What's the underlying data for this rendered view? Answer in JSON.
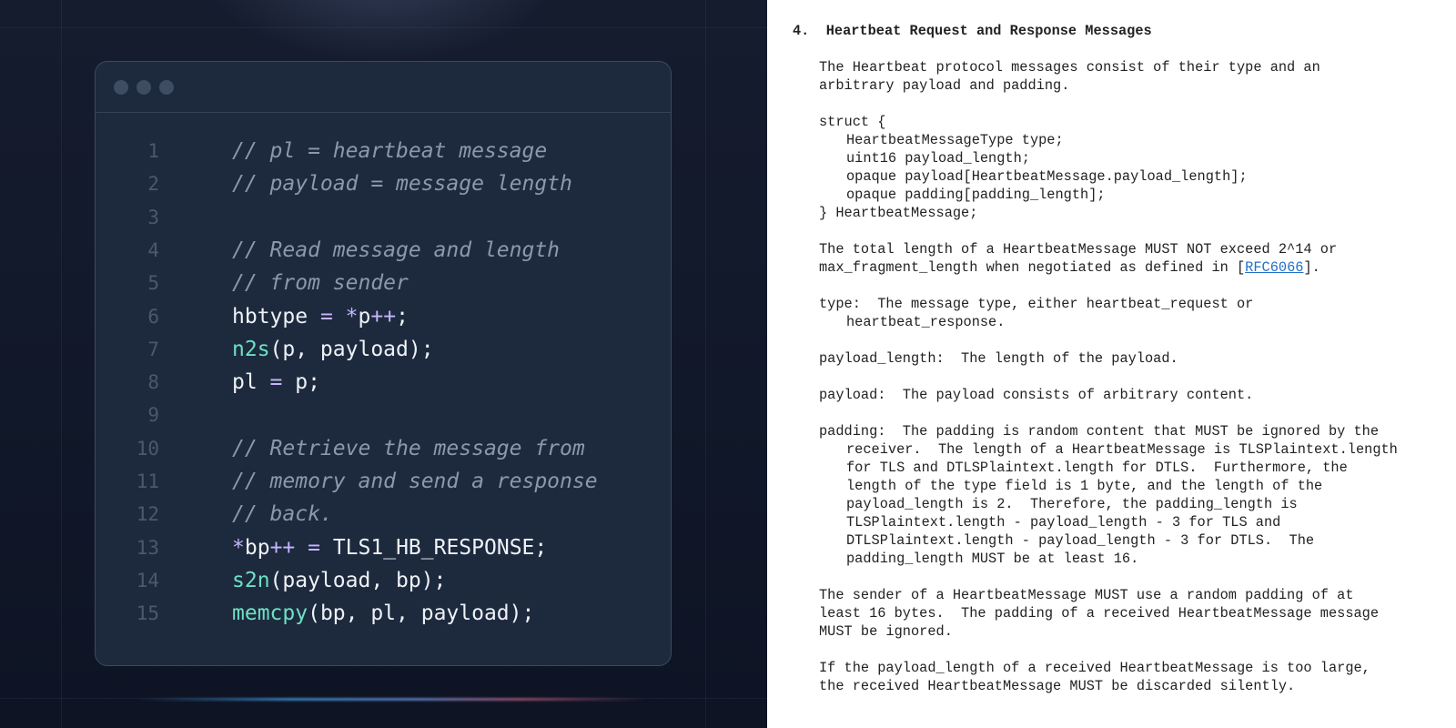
{
  "code_window": {
    "lines": [
      {
        "num": "1",
        "tokens": [
          {
            "t": "// pl = heartbeat message",
            "k": "comment"
          }
        ]
      },
      {
        "num": "2",
        "tokens": [
          {
            "t": "// payload = message length",
            "k": "comment"
          }
        ]
      },
      {
        "num": "3",
        "tokens": []
      },
      {
        "num": "4",
        "tokens": [
          {
            "t": "// Read message and length",
            "k": "comment"
          }
        ]
      },
      {
        "num": "5",
        "tokens": [
          {
            "t": "// from sender",
            "k": "comment"
          }
        ]
      },
      {
        "num": "6",
        "tokens": [
          {
            "t": "hbtype ",
            "k": "plain"
          },
          {
            "t": "=",
            "k": "op"
          },
          {
            "t": " ",
            "k": "plain"
          },
          {
            "t": "*",
            "k": "op"
          },
          {
            "t": "p",
            "k": "plain"
          },
          {
            "t": "++",
            "k": "op"
          },
          {
            "t": ";",
            "k": "plain"
          }
        ]
      },
      {
        "num": "7",
        "tokens": [
          {
            "t": "n2s",
            "k": "fn"
          },
          {
            "t": "(p, payload);",
            "k": "plain"
          }
        ]
      },
      {
        "num": "8",
        "tokens": [
          {
            "t": "pl ",
            "k": "plain"
          },
          {
            "t": "=",
            "k": "op"
          },
          {
            "t": " p;",
            "k": "plain"
          }
        ]
      },
      {
        "num": "9",
        "tokens": []
      },
      {
        "num": "10",
        "tokens": [
          {
            "t": "// Retrieve the message from",
            "k": "comment"
          }
        ]
      },
      {
        "num": "11",
        "tokens": [
          {
            "t": "// memory and send a response",
            "k": "comment"
          }
        ]
      },
      {
        "num": "12",
        "tokens": [
          {
            "t": "// back.",
            "k": "comment"
          }
        ]
      },
      {
        "num": "13",
        "tokens": [
          {
            "t": "*",
            "k": "op"
          },
          {
            "t": "bp",
            "k": "plain"
          },
          {
            "t": "++",
            "k": "op"
          },
          {
            "t": " ",
            "k": "plain"
          },
          {
            "t": "=",
            "k": "op"
          },
          {
            "t": " TLS1_HB_RESPONSE;",
            "k": "plain"
          }
        ]
      },
      {
        "num": "14",
        "tokens": [
          {
            "t": "s2n",
            "k": "fn"
          },
          {
            "t": "(payload, bp);",
            "k": "plain"
          }
        ]
      },
      {
        "num": "15",
        "tokens": [
          {
            "t": "memcpy",
            "k": "fn"
          },
          {
            "t": "(bp, pl, payload);",
            "k": "plain"
          }
        ]
      }
    ]
  },
  "colors": {
    "comment": "#8b98ad",
    "operator": "#c7b5ff",
    "function": "#6ee0c4",
    "plain": "#eef1f6",
    "line_number": "#4a5870",
    "window_bg": "#1d2a3e",
    "panel_bg": "#111829",
    "link": "#1f6fc9"
  },
  "document": {
    "section_title": "4.  Heartbeat Request and Response Messages",
    "lines": [
      {
        "indent": 1,
        "text": "The Heartbeat protocol messages consist of their type and an"
      },
      {
        "indent": 1,
        "text": "arbitrary payload and padding."
      },
      {
        "indent": 1,
        "text": ""
      },
      {
        "indent": 1,
        "text": "struct {"
      },
      {
        "indent": 2,
        "text": "HeartbeatMessageType type;"
      },
      {
        "indent": 2,
        "text": "uint16 payload_length;"
      },
      {
        "indent": 2,
        "text": "opaque payload[HeartbeatMessage.payload_length];"
      },
      {
        "indent": 2,
        "text": "opaque padding[padding_length];"
      },
      {
        "indent": 1,
        "text": "} HeartbeatMessage;"
      },
      {
        "indent": 1,
        "text": ""
      },
      {
        "indent": 1,
        "text": "The total length of a HeartbeatMessage MUST NOT exceed 2^14 or"
      },
      {
        "indent": 1,
        "text": "max_fragment_length when negotiated as defined in [",
        "link": "RFC6066",
        "after": "]."
      },
      {
        "indent": 1,
        "text": ""
      },
      {
        "indent": 1,
        "text": "type:  The message type, either heartbeat_request or"
      },
      {
        "indent": 2,
        "text": "heartbeat_response."
      },
      {
        "indent": 1,
        "text": ""
      },
      {
        "indent": 1,
        "text": "payload_length:  The length of the payload."
      },
      {
        "indent": 1,
        "text": ""
      },
      {
        "indent": 1,
        "text": "payload:  The payload consists of arbitrary content."
      },
      {
        "indent": 1,
        "text": ""
      },
      {
        "indent": 1,
        "text": "padding:  The padding is random content that MUST be ignored by the"
      },
      {
        "indent": 2,
        "text": "receiver.  The length of a HeartbeatMessage is TLSPlaintext.length"
      },
      {
        "indent": 2,
        "text": "for TLS and DTLSPlaintext.length for DTLS.  Furthermore, the"
      },
      {
        "indent": 2,
        "text": "length of the type field is 1 byte, and the length of the"
      },
      {
        "indent": 2,
        "text": "payload_length is 2.  Therefore, the padding_length is"
      },
      {
        "indent": 2,
        "text": "TLSPlaintext.length - payload_length - 3 for TLS and"
      },
      {
        "indent": 2,
        "text": "DTLSPlaintext.length - payload_length - 3 for DTLS.  The"
      },
      {
        "indent": 2,
        "text": "padding_length MUST be at least 16."
      },
      {
        "indent": 1,
        "text": ""
      },
      {
        "indent": 1,
        "text": "The sender of a HeartbeatMessage MUST use a random padding of at"
      },
      {
        "indent": 1,
        "text": "least 16 bytes.  The padding of a received HeartbeatMessage message"
      },
      {
        "indent": 1,
        "text": "MUST be ignored."
      },
      {
        "indent": 1,
        "text": ""
      },
      {
        "indent": 1,
        "text": "If the payload_length of a received HeartbeatMessage is too large,"
      },
      {
        "indent": 1,
        "text": "the received HeartbeatMessage MUST be discarded silently."
      }
    ]
  }
}
